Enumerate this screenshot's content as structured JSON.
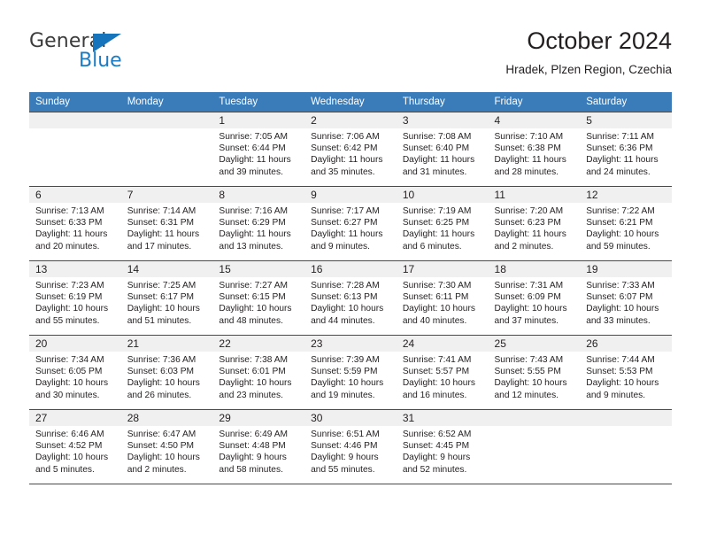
{
  "logo": {
    "primary_text": "General",
    "secondary_text": "Blue",
    "primary_color": "#3b3b3b",
    "secondary_color": "#1b7cc4",
    "triangle_color": "#1574bb"
  },
  "header": {
    "title": "October 2024",
    "subtitle": "Hradek, Plzen Region, Czechia"
  },
  "theme": {
    "header_row_bg": "#3a7cba",
    "header_row_text": "#ffffff",
    "daynum_band_bg": "#f0f0f0",
    "grid_line": "#4a4a4a",
    "text": "#231f20"
  },
  "weekday_headers": [
    "Sunday",
    "Monday",
    "Tuesday",
    "Wednesday",
    "Thursday",
    "Friday",
    "Saturday"
  ],
  "labels": {
    "sunrise_prefix": "Sunrise:",
    "sunset_prefix": "Sunset:",
    "daylight_prefix": "Daylight:"
  },
  "weeks": [
    [
      {
        "day": "",
        "empty": true
      },
      {
        "day": "",
        "empty": true
      },
      {
        "day": "1",
        "sunrise": "Sunrise: 7:05 AM",
        "sunset": "Sunset: 6:44 PM",
        "daylight_1": "Daylight: 11 hours",
        "daylight_2": "and 39 minutes."
      },
      {
        "day": "2",
        "sunrise": "Sunrise: 7:06 AM",
        "sunset": "Sunset: 6:42 PM",
        "daylight_1": "Daylight: 11 hours",
        "daylight_2": "and 35 minutes."
      },
      {
        "day": "3",
        "sunrise": "Sunrise: 7:08 AM",
        "sunset": "Sunset: 6:40 PM",
        "daylight_1": "Daylight: 11 hours",
        "daylight_2": "and 31 minutes."
      },
      {
        "day": "4",
        "sunrise": "Sunrise: 7:10 AM",
        "sunset": "Sunset: 6:38 PM",
        "daylight_1": "Daylight: 11 hours",
        "daylight_2": "and 28 minutes."
      },
      {
        "day": "5",
        "sunrise": "Sunrise: 7:11 AM",
        "sunset": "Sunset: 6:36 PM",
        "daylight_1": "Daylight: 11 hours",
        "daylight_2": "and 24 minutes."
      }
    ],
    [
      {
        "day": "6",
        "sunrise": "Sunrise: 7:13 AM",
        "sunset": "Sunset: 6:33 PM",
        "daylight_1": "Daylight: 11 hours",
        "daylight_2": "and 20 minutes."
      },
      {
        "day": "7",
        "sunrise": "Sunrise: 7:14 AM",
        "sunset": "Sunset: 6:31 PM",
        "daylight_1": "Daylight: 11 hours",
        "daylight_2": "and 17 minutes."
      },
      {
        "day": "8",
        "sunrise": "Sunrise: 7:16 AM",
        "sunset": "Sunset: 6:29 PM",
        "daylight_1": "Daylight: 11 hours",
        "daylight_2": "and 13 minutes."
      },
      {
        "day": "9",
        "sunrise": "Sunrise: 7:17 AM",
        "sunset": "Sunset: 6:27 PM",
        "daylight_1": "Daylight: 11 hours",
        "daylight_2": "and 9 minutes."
      },
      {
        "day": "10",
        "sunrise": "Sunrise: 7:19 AM",
        "sunset": "Sunset: 6:25 PM",
        "daylight_1": "Daylight: 11 hours",
        "daylight_2": "and 6 minutes."
      },
      {
        "day": "11",
        "sunrise": "Sunrise: 7:20 AM",
        "sunset": "Sunset: 6:23 PM",
        "daylight_1": "Daylight: 11 hours",
        "daylight_2": "and 2 minutes."
      },
      {
        "day": "12",
        "sunrise": "Sunrise: 7:22 AM",
        "sunset": "Sunset: 6:21 PM",
        "daylight_1": "Daylight: 10 hours",
        "daylight_2": "and 59 minutes."
      }
    ],
    [
      {
        "day": "13",
        "sunrise": "Sunrise: 7:23 AM",
        "sunset": "Sunset: 6:19 PM",
        "daylight_1": "Daylight: 10 hours",
        "daylight_2": "and 55 minutes."
      },
      {
        "day": "14",
        "sunrise": "Sunrise: 7:25 AM",
        "sunset": "Sunset: 6:17 PM",
        "daylight_1": "Daylight: 10 hours",
        "daylight_2": "and 51 minutes."
      },
      {
        "day": "15",
        "sunrise": "Sunrise: 7:27 AM",
        "sunset": "Sunset: 6:15 PM",
        "daylight_1": "Daylight: 10 hours",
        "daylight_2": "and 48 minutes."
      },
      {
        "day": "16",
        "sunrise": "Sunrise: 7:28 AM",
        "sunset": "Sunset: 6:13 PM",
        "daylight_1": "Daylight: 10 hours",
        "daylight_2": "and 44 minutes."
      },
      {
        "day": "17",
        "sunrise": "Sunrise: 7:30 AM",
        "sunset": "Sunset: 6:11 PM",
        "daylight_1": "Daylight: 10 hours",
        "daylight_2": "and 40 minutes."
      },
      {
        "day": "18",
        "sunrise": "Sunrise: 7:31 AM",
        "sunset": "Sunset: 6:09 PM",
        "daylight_1": "Daylight: 10 hours",
        "daylight_2": "and 37 minutes."
      },
      {
        "day": "19",
        "sunrise": "Sunrise: 7:33 AM",
        "sunset": "Sunset: 6:07 PM",
        "daylight_1": "Daylight: 10 hours",
        "daylight_2": "and 33 minutes."
      }
    ],
    [
      {
        "day": "20",
        "sunrise": "Sunrise: 7:34 AM",
        "sunset": "Sunset: 6:05 PM",
        "daylight_1": "Daylight: 10 hours",
        "daylight_2": "and 30 minutes."
      },
      {
        "day": "21",
        "sunrise": "Sunrise: 7:36 AM",
        "sunset": "Sunset: 6:03 PM",
        "daylight_1": "Daylight: 10 hours",
        "daylight_2": "and 26 minutes."
      },
      {
        "day": "22",
        "sunrise": "Sunrise: 7:38 AM",
        "sunset": "Sunset: 6:01 PM",
        "daylight_1": "Daylight: 10 hours",
        "daylight_2": "and 23 minutes."
      },
      {
        "day": "23",
        "sunrise": "Sunrise: 7:39 AM",
        "sunset": "Sunset: 5:59 PM",
        "daylight_1": "Daylight: 10 hours",
        "daylight_2": "and 19 minutes."
      },
      {
        "day": "24",
        "sunrise": "Sunrise: 7:41 AM",
        "sunset": "Sunset: 5:57 PM",
        "daylight_1": "Daylight: 10 hours",
        "daylight_2": "and 16 minutes."
      },
      {
        "day": "25",
        "sunrise": "Sunrise: 7:43 AM",
        "sunset": "Sunset: 5:55 PM",
        "daylight_1": "Daylight: 10 hours",
        "daylight_2": "and 12 minutes."
      },
      {
        "day": "26",
        "sunrise": "Sunrise: 7:44 AM",
        "sunset": "Sunset: 5:53 PM",
        "daylight_1": "Daylight: 10 hours",
        "daylight_2": "and 9 minutes."
      }
    ],
    [
      {
        "day": "27",
        "sunrise": "Sunrise: 6:46 AM",
        "sunset": "Sunset: 4:52 PM",
        "daylight_1": "Daylight: 10 hours",
        "daylight_2": "and 5 minutes."
      },
      {
        "day": "28",
        "sunrise": "Sunrise: 6:47 AM",
        "sunset": "Sunset: 4:50 PM",
        "daylight_1": "Daylight: 10 hours",
        "daylight_2": "and 2 minutes."
      },
      {
        "day": "29",
        "sunrise": "Sunrise: 6:49 AM",
        "sunset": "Sunset: 4:48 PM",
        "daylight_1": "Daylight: 9 hours",
        "daylight_2": "and 58 minutes."
      },
      {
        "day": "30",
        "sunrise": "Sunrise: 6:51 AM",
        "sunset": "Sunset: 4:46 PM",
        "daylight_1": "Daylight: 9 hours",
        "daylight_2": "and 55 minutes."
      },
      {
        "day": "31",
        "sunrise": "Sunrise: 6:52 AM",
        "sunset": "Sunset: 4:45 PM",
        "daylight_1": "Daylight: 9 hours",
        "daylight_2": "and 52 minutes."
      },
      {
        "day": "",
        "empty": true
      },
      {
        "day": "",
        "empty": true
      }
    ]
  ]
}
